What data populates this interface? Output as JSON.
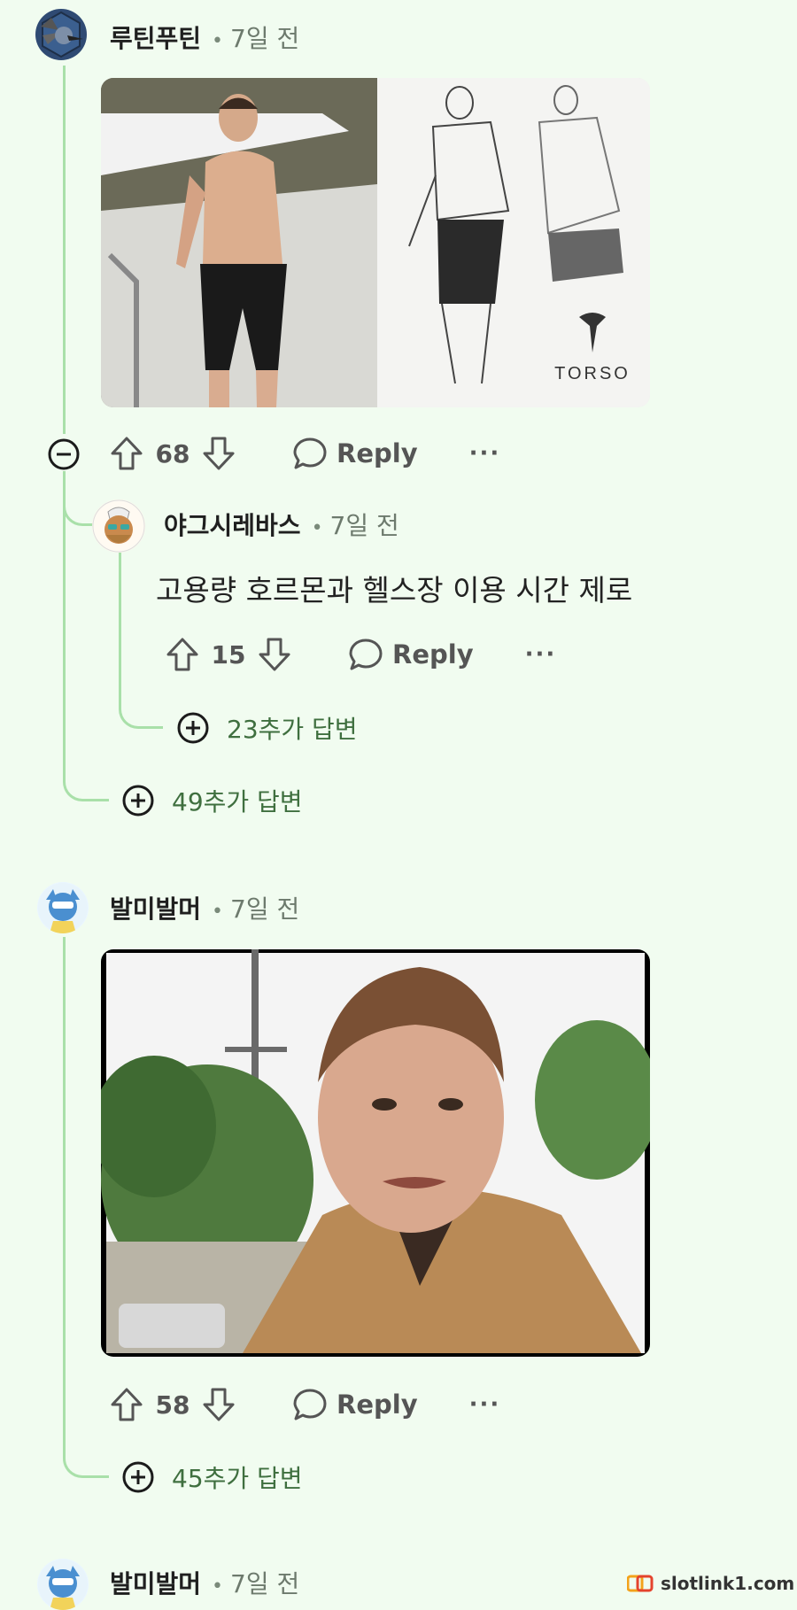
{
  "comments": [
    {
      "username": "루틴푸틴",
      "time": "7일 전",
      "vote_count": "68",
      "reply_label": "Reply",
      "more_label": "···",
      "media_desc": "",
      "replies": [
        {
          "username": "야그시레바스",
          "time": "7일 전",
          "text": "고용량 호르몬과 헬스장 이용 시간 제로",
          "vote_count": "15",
          "reply_label": "Reply",
          "more_label": "···",
          "more_replies": "23추가 답변"
        }
      ],
      "more_replies": "49추가 답변"
    },
    {
      "username": "발미발머",
      "time": "7일 전",
      "vote_count": "58",
      "reply_label": "Reply",
      "more_label": "···",
      "more_replies": "45추가 답변"
    },
    {
      "username": "발미발머",
      "time": "7일 전"
    }
  ],
  "image1": {
    "logo_text": "TORSO"
  },
  "watermark": {
    "text": "slotlink1.com"
  },
  "colors": {
    "background": "#f1fcf0",
    "thread_line": "#a9e0a9"
  }
}
